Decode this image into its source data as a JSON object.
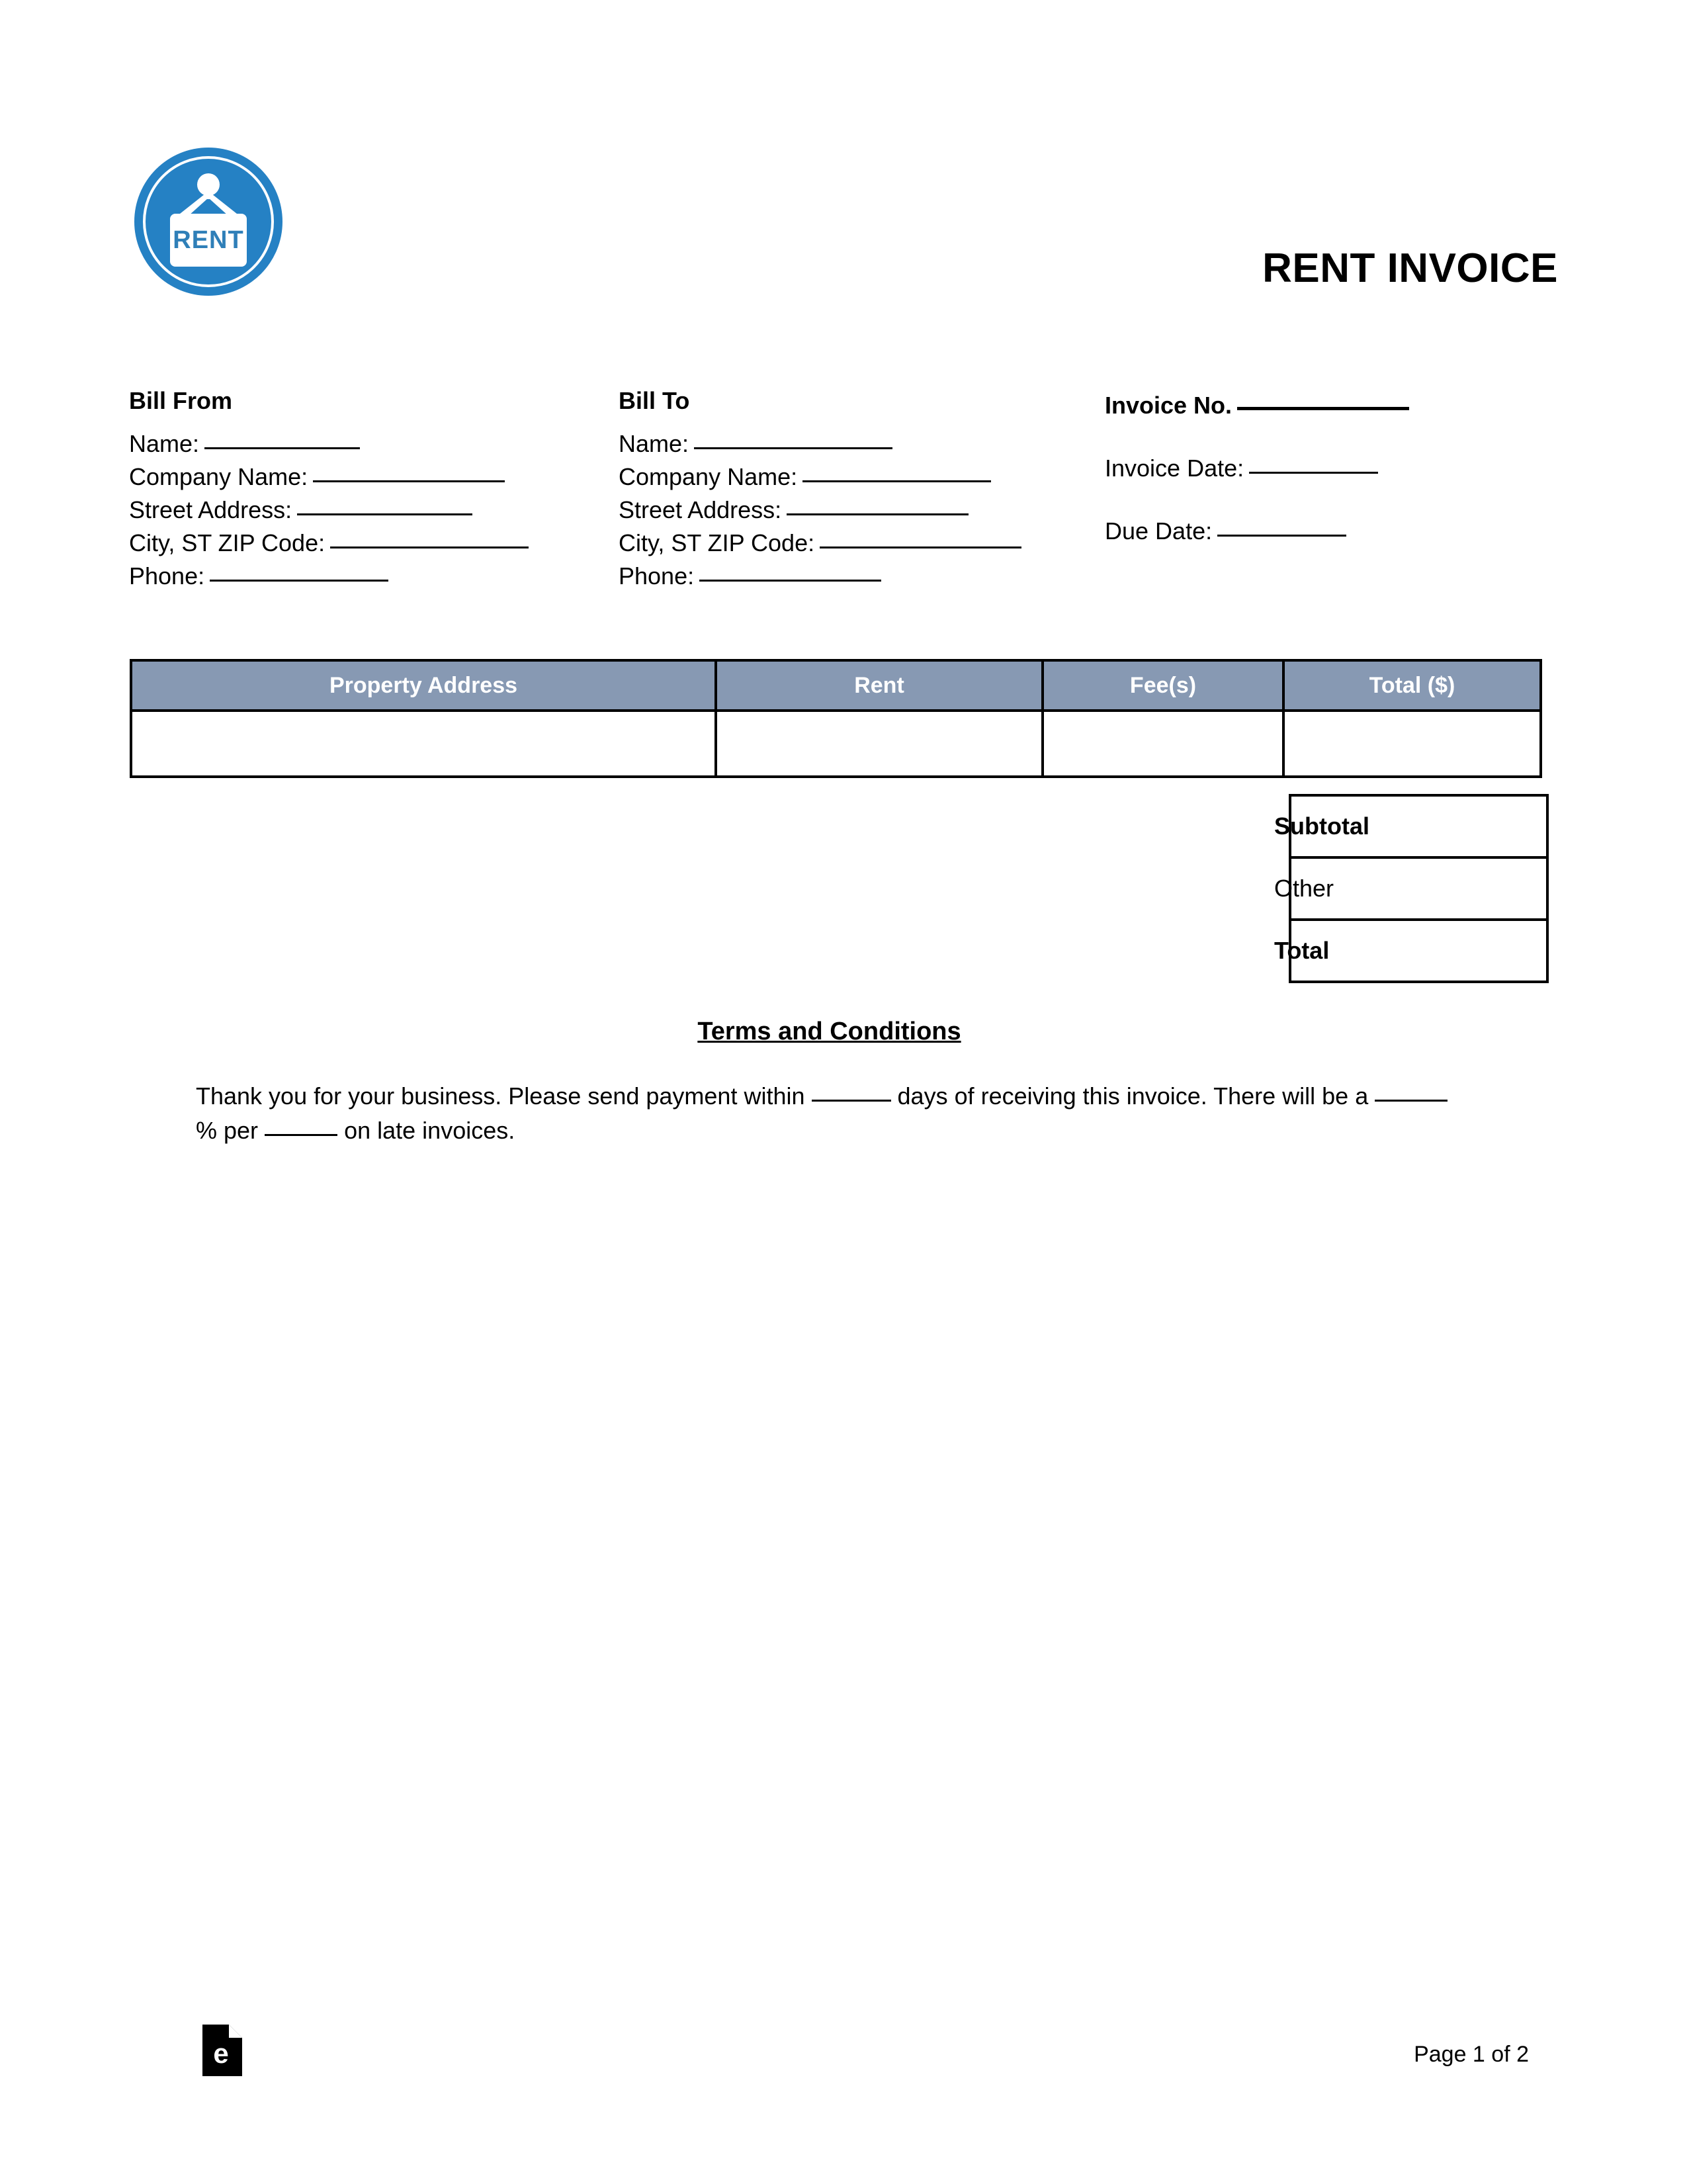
{
  "document": {
    "title": "RENT INVOICE",
    "logo_icon": "rent-sign-circle-logo",
    "brand_blue": "#2581c4",
    "table_header_fill": "#8799b3"
  },
  "bill_from": {
    "heading": "Bill From",
    "fields": [
      {
        "label": "Name:",
        "value": ""
      },
      {
        "label": "Company Name:",
        "value": ""
      },
      {
        "label": "Street Address:",
        "value": ""
      },
      {
        "label": "City, ST ZIP Code:",
        "value": ""
      },
      {
        "label": "Phone:",
        "value": ""
      }
    ]
  },
  "bill_to": {
    "heading": "Bill To",
    "fields": [
      {
        "label": "Name:",
        "value": ""
      },
      {
        "label": "Company Name:",
        "value": ""
      },
      {
        "label": "Street Address:",
        "value": ""
      },
      {
        "label": "City, ST ZIP Code:",
        "value": ""
      },
      {
        "label": "Phone:",
        "value": ""
      }
    ]
  },
  "invoice_meta": {
    "invoice_no_label": "Invoice No.",
    "invoice_no_value": "",
    "invoice_date_label": "Invoice Date:",
    "invoice_date_value": "",
    "due_date_label": "Due Date:",
    "due_date_value": ""
  },
  "line_items_table": {
    "columns": [
      "Property Address",
      "Rent",
      "Fee(s)",
      "Total ($)"
    ],
    "rows": [
      {
        "property_address": "",
        "rent": "",
        "fees": "",
        "total": ""
      }
    ]
  },
  "totals": [
    {
      "label": "Subtotal",
      "value": "",
      "bold": true
    },
    {
      "label": "Other",
      "value": "",
      "bold": false
    },
    {
      "label": "Total",
      "value": "",
      "bold": true
    }
  ],
  "terms": {
    "title": "Terms and Conditions",
    "text_part_1": "Thank you for your business. Please send payment within",
    "text_part_2": "days of receiving this invoice. There will be a",
    "text_part_3": "% per",
    "text_part_4": "on late invoices.",
    "days_value": "",
    "percent_value": "",
    "period_value": ""
  },
  "footer": {
    "brand_icon": "eforms-document-logo",
    "brand_letter": "e",
    "page_label": "Page 1 of 2"
  }
}
